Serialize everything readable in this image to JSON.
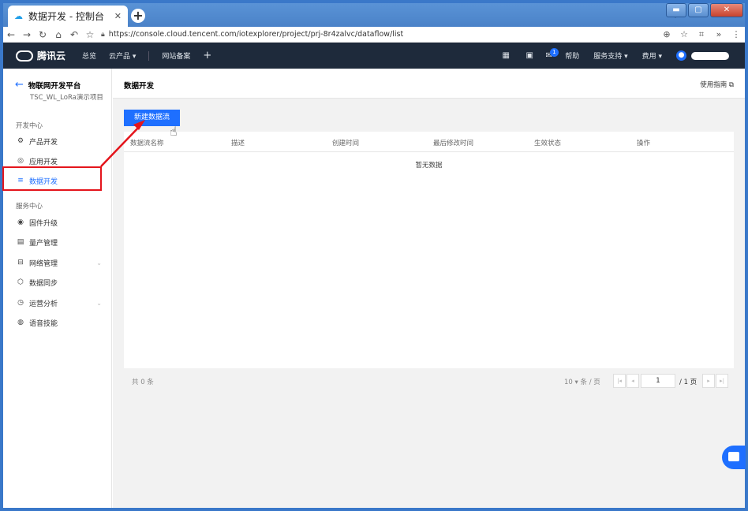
{
  "browser": {
    "tab_title": "数据开发 - 控制台",
    "url": "https://console.cloud.tencent.com/iotexplorer/project/prj-8r4zalvc/dataflow/list"
  },
  "topnav": {
    "brand": "腾讯云",
    "overview": "总览",
    "products": "云产品 ▾",
    "icp": "网站备案",
    "plus": "+",
    "mail_badge": "1",
    "help": "帮助",
    "support": "服务支持 ▾",
    "billing": "费用 ▾"
  },
  "sidebar": {
    "platform": "物联网开发平台",
    "project": "TSC_WL_LoRa演示项目",
    "dev_center": "开发中心",
    "service_center": "服务中心",
    "dev_items": [
      {
        "label": "产品开发",
        "icon": "⚙"
      },
      {
        "label": "应用开发",
        "icon": "◎"
      },
      {
        "label": "数据开发",
        "icon": "≡"
      }
    ],
    "service_items": [
      {
        "label": "固件升级",
        "icon": "◉"
      },
      {
        "label": "量产管理",
        "icon": "▤"
      },
      {
        "label": "网络管理",
        "icon": "⊟"
      },
      {
        "label": "数据同步",
        "icon": "⬡"
      },
      {
        "label": "运营分析",
        "icon": "◷"
      },
      {
        "label": "语音技能",
        "icon": "◍"
      }
    ],
    "chevron": "⌄"
  },
  "main": {
    "title": "数据开发",
    "guide": "使用指南 ⧉",
    "new_button": "新建数据流",
    "columns": [
      "数据流名称",
      "描述",
      "创建时间",
      "最后修改时间",
      "生效状态",
      "操作"
    ],
    "empty_text": "暂无数据",
    "total": "共 0 条",
    "page_size": "10 ▾  条 / 页",
    "page_input": "1",
    "page_total": "/ 1 页"
  },
  "colors": {
    "accent": "#1e6fff",
    "highlight": "#e4151c",
    "nav_bg": "#1e2a3b"
  }
}
